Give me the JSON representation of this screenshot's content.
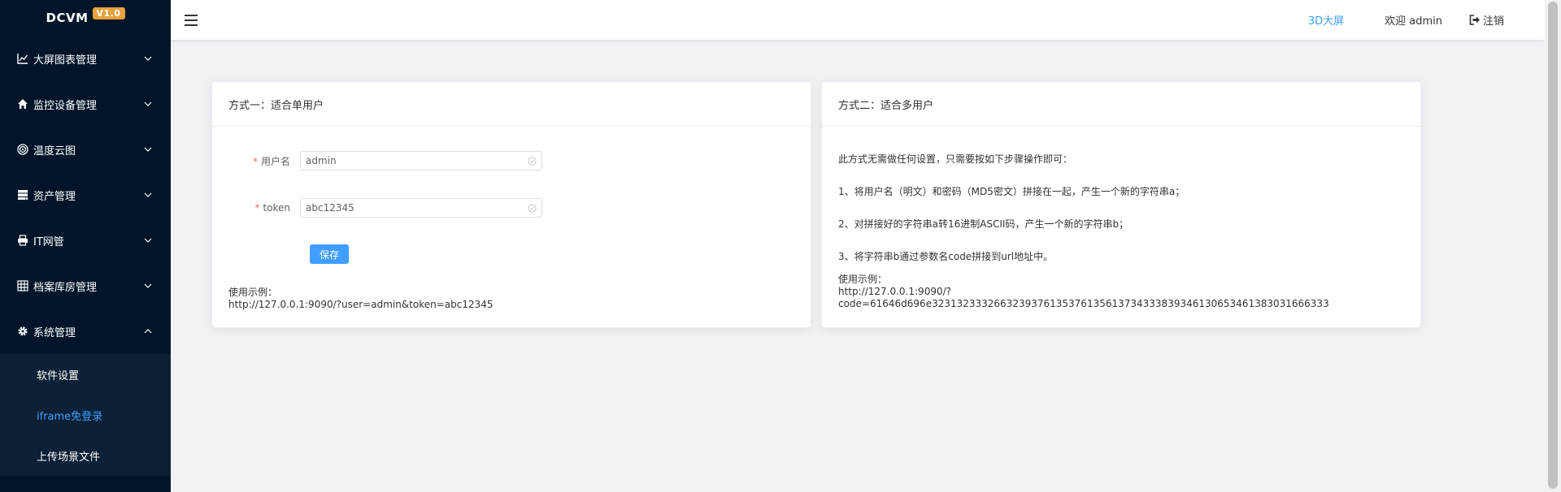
{
  "app": {
    "brand": "DCVM",
    "version": "V1.0"
  },
  "sidebar": {
    "items": [
      {
        "label": "大屏图表管理",
        "icon": "line-chart-icon"
      },
      {
        "label": "监控设备管理",
        "icon": "home-icon"
      },
      {
        "label": "温度云图",
        "icon": "target-icon"
      },
      {
        "label": "资产管理",
        "icon": "server-icon"
      },
      {
        "label": "IT网管",
        "icon": "printer-icon"
      },
      {
        "label": "档案库房管理",
        "icon": "grid-icon"
      },
      {
        "label": "系统管理",
        "icon": "gear-icon",
        "expanded": true
      }
    ],
    "subitems": [
      {
        "label": "软件设置"
      },
      {
        "label": "iframe免登录",
        "active": true
      },
      {
        "label": "上传场景文件"
      }
    ]
  },
  "header": {
    "link_3d": "3D大屏",
    "welcome": "欢迎 admin",
    "logout": "注销"
  },
  "card1": {
    "title": "方式一：适合单用户",
    "fields": [
      {
        "label": "用户名",
        "value": "admin"
      },
      {
        "label": "token",
        "value": "abc12345"
      }
    ],
    "save": "保存",
    "example_label": "使用示例：",
    "example_url": "http://127.0.0.1:9090/?user=admin&token=abc12345"
  },
  "card2": {
    "title": "方式二：适合多用户",
    "steps": [
      "此方式无需做任何设置，只需要按如下步骤操作即可：",
      "1、将用户名（明文）和密码（MD5密文）拼接在一起，产生一个新的字符串a；",
      "2、对拼接好的字符串a转16进制ASCII码，产生一个新的字符串b；",
      "3、将字符串b通过参数名code拼接到url地址中。"
    ],
    "example_label": "使用示例：",
    "example_url": "http://127.0.0.1:9090/?code=61646d696e3231323332663239376135376135613734333839346130653461383031666333"
  },
  "colors": {
    "sidebar_bg": "#001529",
    "accent": "#409eff",
    "badge": "#e6a23c"
  }
}
